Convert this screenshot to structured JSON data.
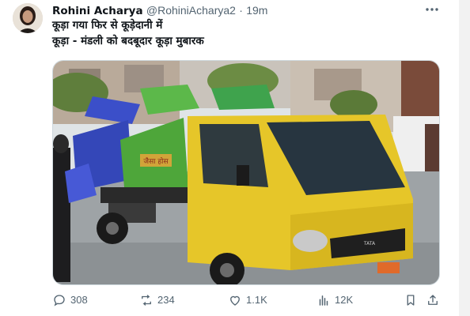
{
  "post": {
    "author_name": "Rohini Acharya",
    "handle": "@RohiniAcharya2",
    "separator": "·",
    "time": "19m",
    "text_lines": [
      "कूड़ा गया फिर से कूड़ेदानी में",
      "कूड़ा - मंडली को बदबूदार कूड़ा मुबारक"
    ],
    "image": {
      "truck_side_text": "जैसा होस",
      "truck_brand": "TATA"
    }
  },
  "actions": {
    "replies": "308",
    "reposts": "234",
    "likes": "1.1K",
    "views": "12K"
  },
  "icons": {
    "more": "more-icon",
    "reply": "reply-icon",
    "repost": "repost-icon",
    "like": "like-icon",
    "views": "views-icon",
    "bookmark": "bookmark-icon",
    "share": "share-icon"
  },
  "colors": {
    "text_primary": "#0f1419",
    "text_secondary": "#536471",
    "border": "#cfd9de",
    "truck_yellow": "#e6c629",
    "bin_green": "#4ea63a",
    "bin_blue": "#3b4fc9"
  }
}
